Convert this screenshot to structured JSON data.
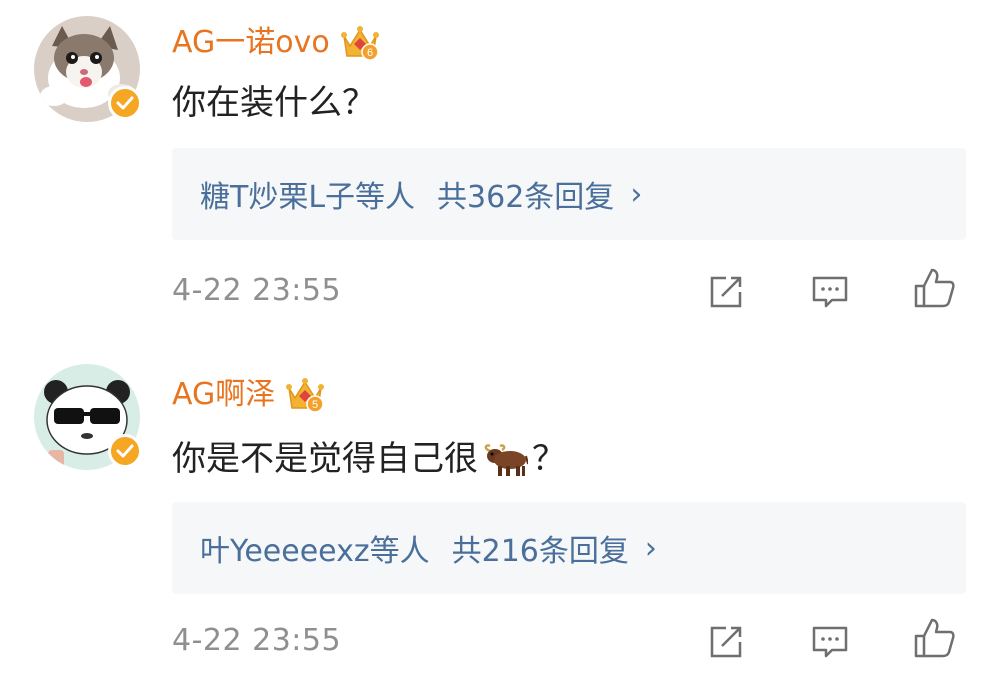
{
  "comments": [
    {
      "username": "AG一诺ovo",
      "text_before": "你在装什么？",
      "text_after": "",
      "reply_names": "糖T炒栗L子",
      "reply_suffix": "等人",
      "reply_count": "共362条回复",
      "reply_arrow": "›",
      "time": "4-22 23:55",
      "crown_level": "6"
    },
    {
      "username": "AG啊泽",
      "text_before": "你是不是觉得自己很",
      "text_after": "？",
      "emoji": "bull-emoji",
      "reply_names": "叶Yeeeeexz",
      "reply_suffix": "等人",
      "reply_count": "共216条回复",
      "reply_arrow": "›",
      "time": "4-22 23:55",
      "crown_level": "5"
    }
  ],
  "colors": {
    "username": "#e8741f",
    "reply_link": "#4a6f9a",
    "timestamp": "#8f8f8f",
    "reply_bg": "#f6f7f9",
    "verified_badge": "#f5a623"
  },
  "icons": [
    "share-icon",
    "comment-icon",
    "like-icon",
    "crown-badge-icon",
    "verified-icon"
  ]
}
